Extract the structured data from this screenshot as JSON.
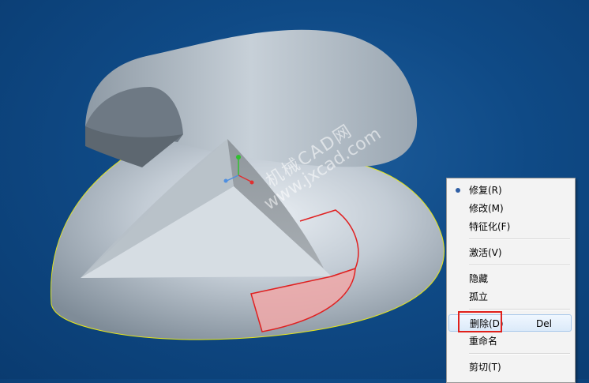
{
  "watermark": {
    "line1": "机械CAD网",
    "line2": "www.jxcad.com"
  },
  "context_menu": {
    "items": [
      {
        "label": "修复(R)",
        "selected": true
      },
      {
        "label": "修改(M)"
      },
      {
        "label": "特征化(F)"
      },
      {
        "label": "激活(V)"
      },
      {
        "label": "隐藏"
      },
      {
        "label": "孤立"
      },
      {
        "label": "删除(D)",
        "shortcut": "Del",
        "hovered": true
      },
      {
        "label": "重命名"
      },
      {
        "label": "剪切(T)"
      }
    ]
  },
  "colors": {
    "background": "#0f4a86",
    "model_surface": "#b8c4cf",
    "selection_edge": "#e02020",
    "selection_fill": "#f0a8a8",
    "highlight_box": "#e0201b",
    "x_axis": "#e03030",
    "y_axis": "#30c030",
    "z_axis": "#4f8fe0"
  }
}
